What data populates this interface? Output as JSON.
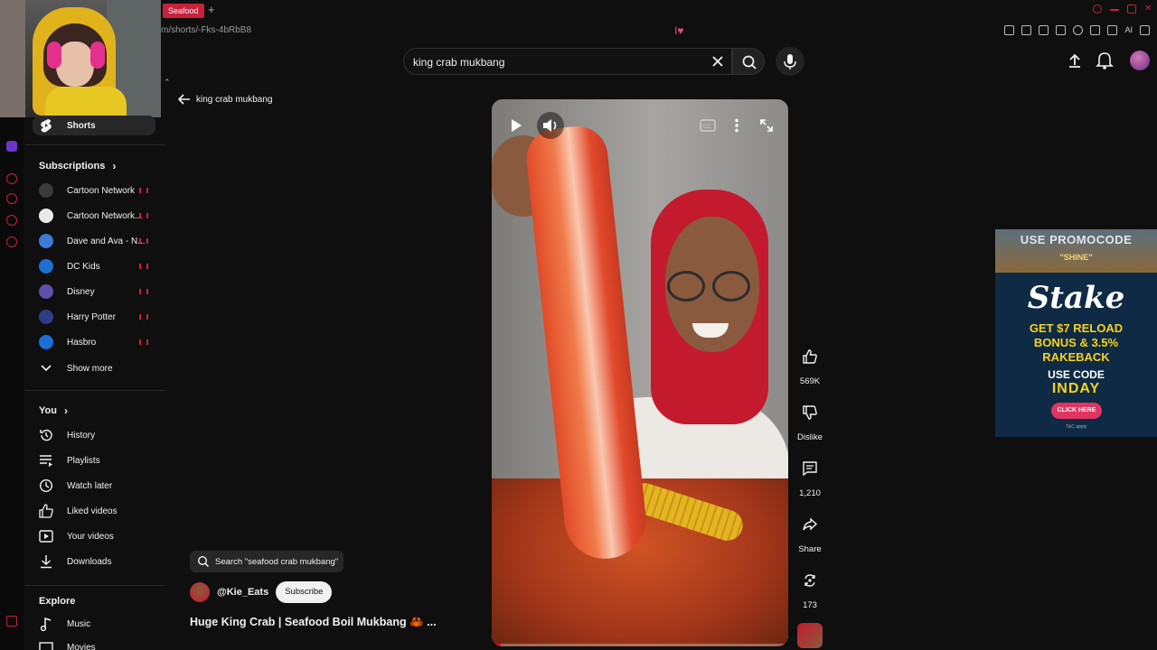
{
  "browser": {
    "tab_label": "Seafood",
    "tab_add": "+",
    "url": "m/shorts/-Fks-4bRbB8",
    "ext_ai": "AI"
  },
  "search": {
    "query": "king crab mukbang"
  },
  "sidebar": {
    "shorts_label": "Shorts",
    "subscriptions_title": "Subscriptions",
    "subscriptions": [
      {
        "label": "Cartoon Network",
        "color": "#3a3a3a"
      },
      {
        "label": "Cartoon Network...",
        "color": "#e9e9e9"
      },
      {
        "label": "Dave and Ava - N...",
        "color": "#3c7bd6"
      },
      {
        "label": "DC Kids",
        "color": "#1f6fd1"
      },
      {
        "label": "Disney",
        "color": "#5e4fa8"
      },
      {
        "label": "Harry Potter",
        "color": "#2f3d86"
      },
      {
        "label": "Hasbro",
        "color": "#1d6ed8"
      }
    ],
    "show_more": "Show more",
    "you_title": "You",
    "you_items": [
      {
        "label": "History",
        "icon": "history-icon"
      },
      {
        "label": "Playlists",
        "icon": "playlists-icon"
      },
      {
        "label": "Watch later",
        "icon": "watch-later-icon"
      },
      {
        "label": "Liked videos",
        "icon": "liked-icon"
      },
      {
        "label": "Your videos",
        "icon": "your-videos-icon"
      },
      {
        "label": "Downloads",
        "icon": "downloads-icon"
      }
    ],
    "explore_title": "Explore",
    "explore_items": [
      {
        "label": "Music",
        "icon": "music-icon"
      },
      {
        "label": "Movies",
        "icon": "movies-icon"
      }
    ]
  },
  "shorts": {
    "back_label": "king crab mukbang",
    "search_pill": "Search \"seafood crab mukbang\"",
    "channel": "@Kie_Eats",
    "subscribe": "Subscribe",
    "title": "Huge King Crab | Seafood Boil Mukbang 🦀 ...",
    "progress": 0.03,
    "actions": {
      "likes": "569K",
      "dislike": "Dislike",
      "comments": "1,210",
      "share": "Share",
      "remix": "173"
    }
  },
  "ad": {
    "promo": "USE PROMOCODE",
    "promo_code": "\"SHINE\"",
    "brand": "Stake",
    "line1": "GET $7 RELOAD",
    "line2": "BONUS & 3.5%",
    "line3": "RAKEBACK",
    "use_code": "USE CODE",
    "code": "INDAY",
    "button": "CLICK HERE",
    "terms": "T&C apply"
  }
}
